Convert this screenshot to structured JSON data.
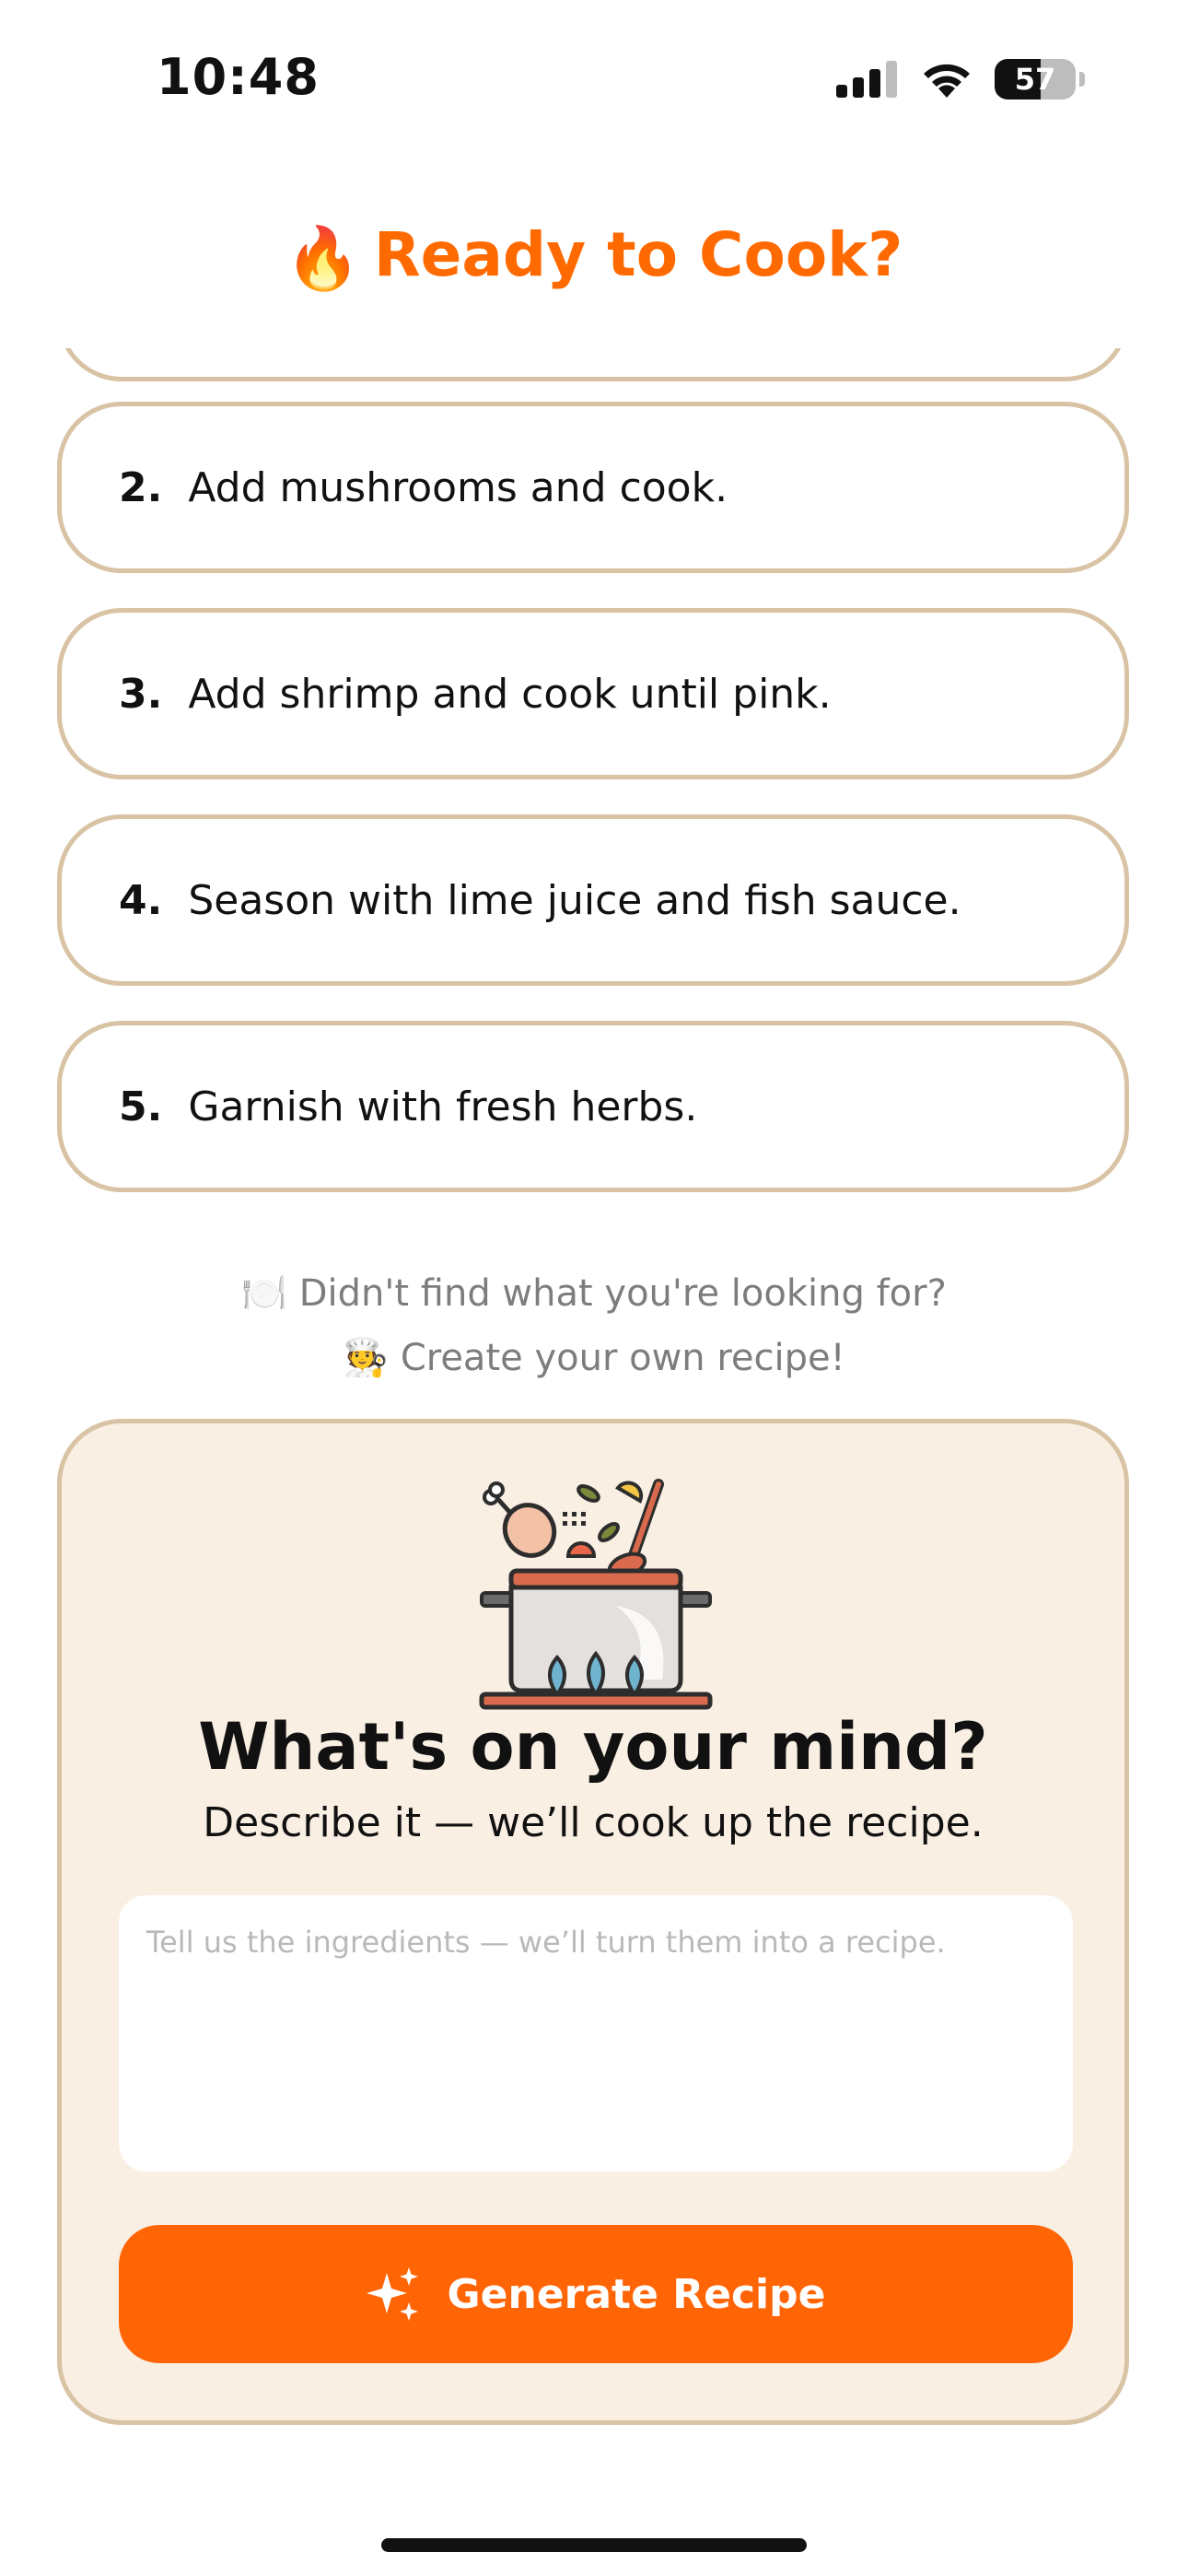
{
  "status_bar": {
    "time": "10:48",
    "battery_level": "57",
    "battery_fraction": 0.57,
    "icons": [
      "cellular-signal-icon",
      "wifi-icon",
      "battery-icon"
    ]
  },
  "header": {
    "emoji": "🔥",
    "title": "Ready to Cook?"
  },
  "steps": [
    {
      "number": "2.",
      "text": "Add mushrooms and cook."
    },
    {
      "number": "3.",
      "text": "Add shrimp and cook until pink."
    },
    {
      "number": "4.",
      "text": "Season with lime juice and fish sauce."
    },
    {
      "number": "5.",
      "text": "Garnish with fresh herbs."
    }
  ],
  "prompt": {
    "line1_emoji": "🍽️",
    "line1": "Didn't find what you're looking for?",
    "line2_emoji": "🧑‍🍳",
    "line2": "Create your own recipe!"
  },
  "create_card": {
    "title": "What's on your mind?",
    "subtitle": "Describe it — we’ll cook up the recipe.",
    "input_value": "",
    "input_placeholder": "Tell us the ingredients — we’ll turn them into a recipe.",
    "button_label": "Generate Recipe",
    "button_icon": "sparkles-icon"
  },
  "colors": {
    "accent": "#ff6405",
    "title_orange": "#ff6a00",
    "card_border": "#d9c3a5",
    "card_background": "#f9efe3"
  }
}
